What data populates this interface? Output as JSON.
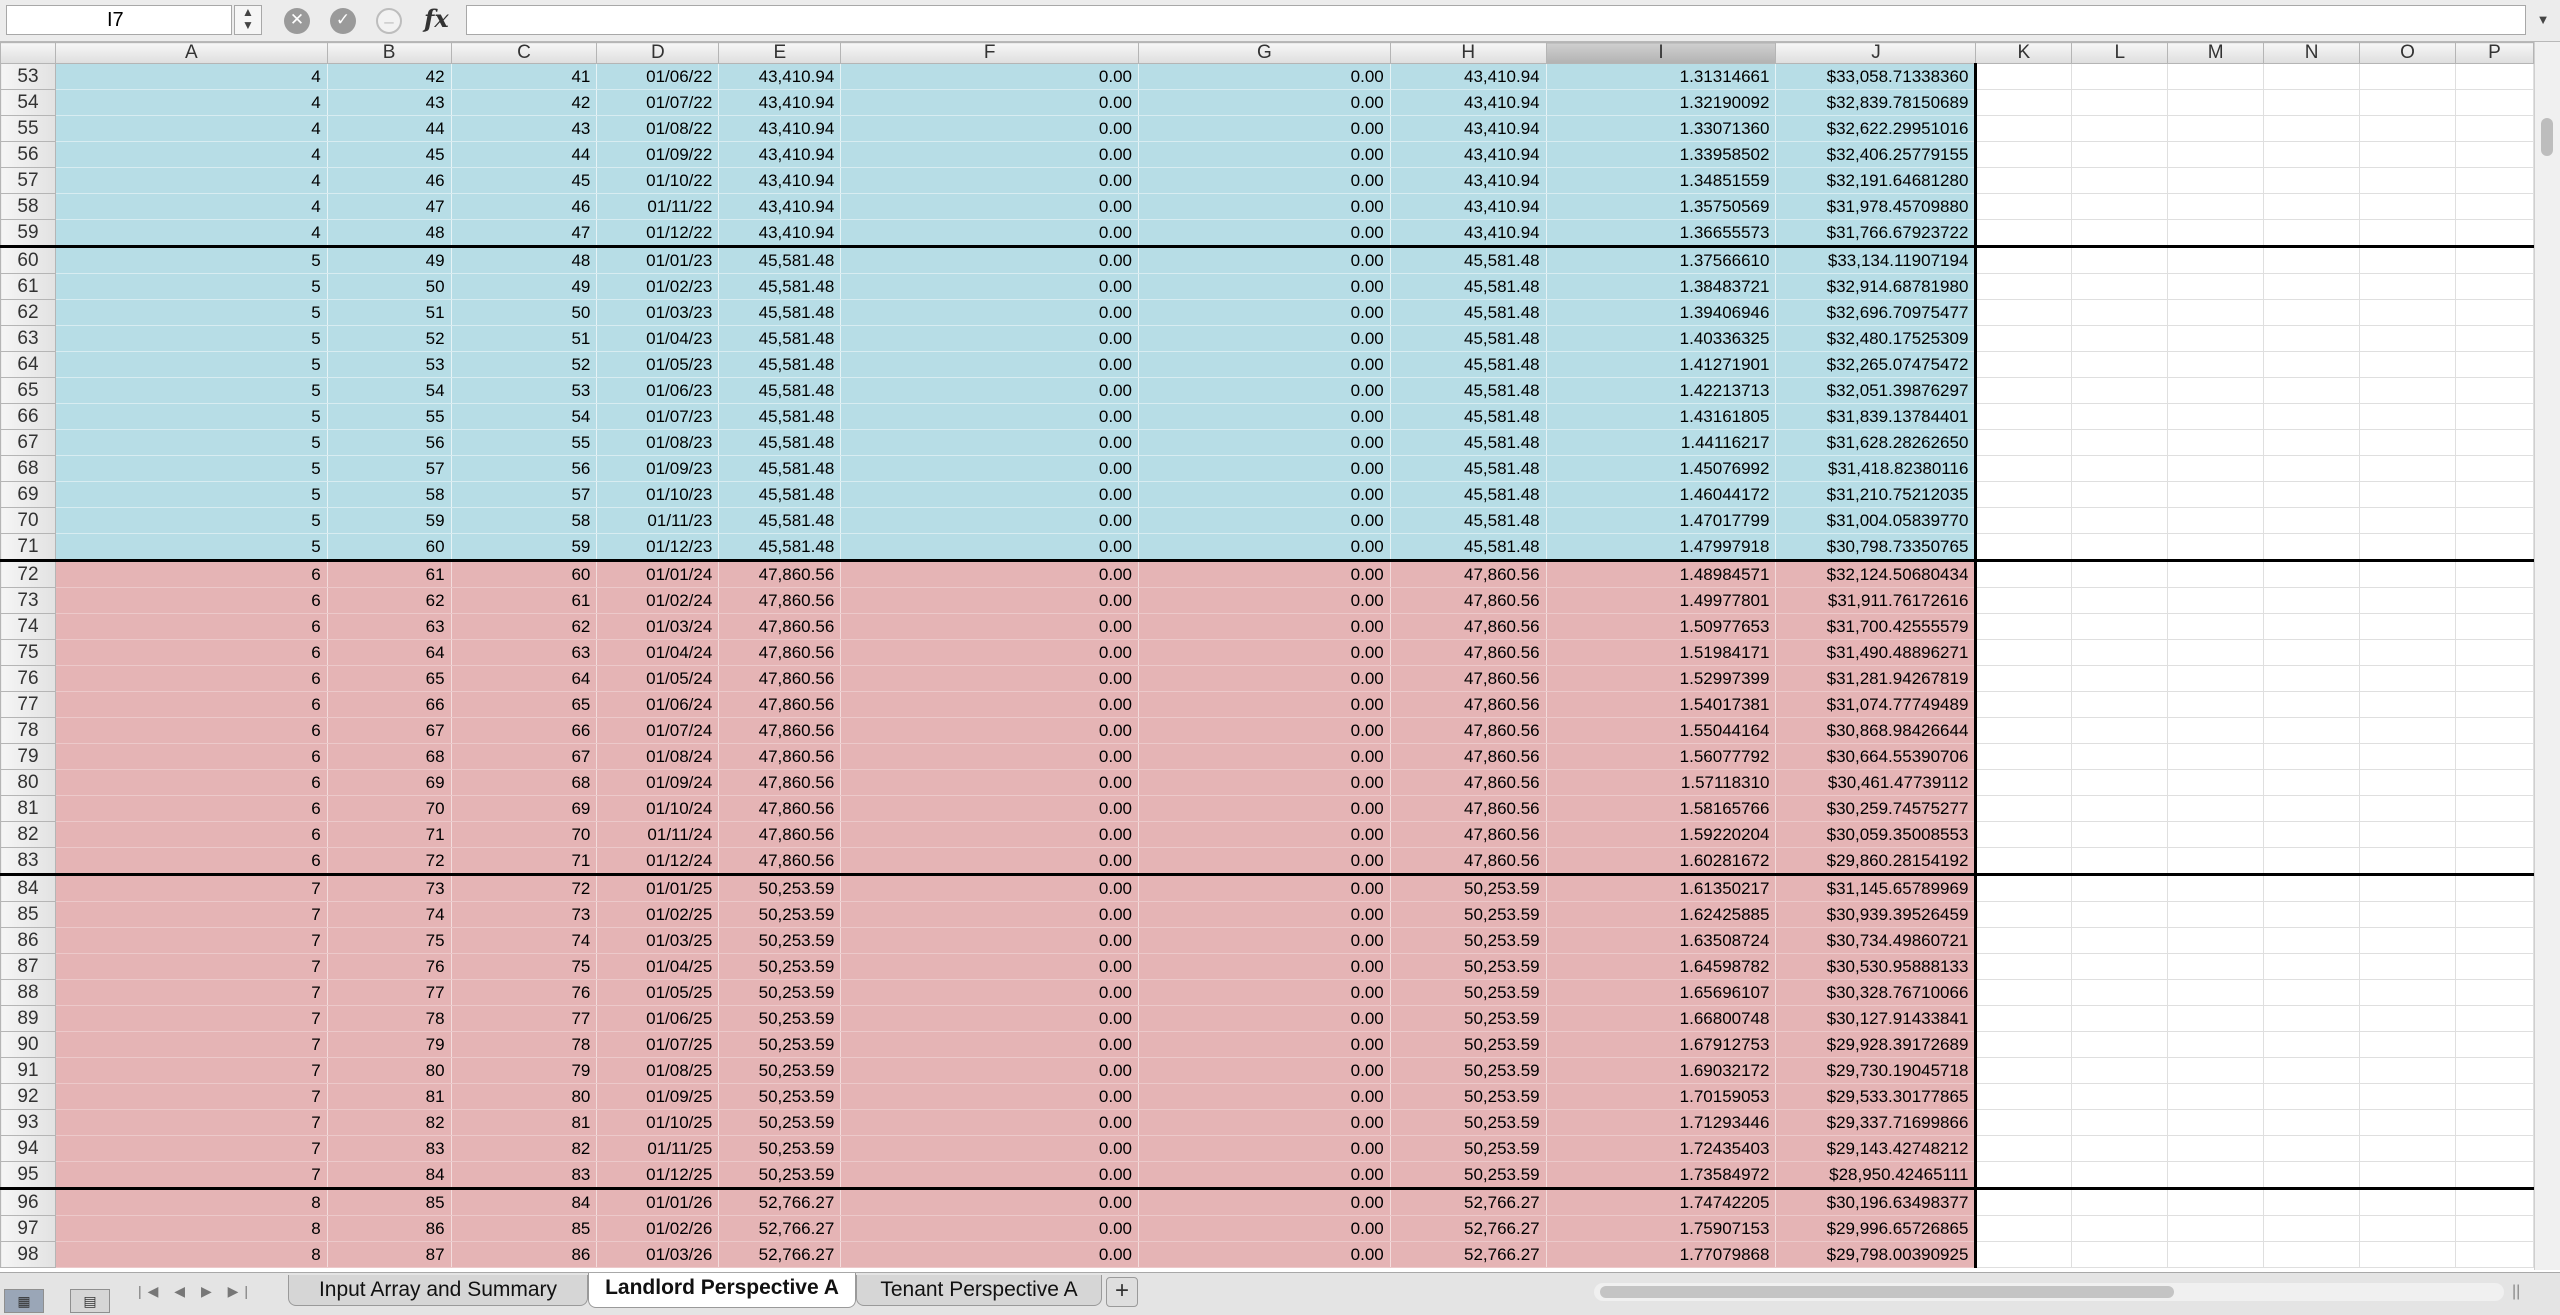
{
  "formula_bar": {
    "cell_ref": "I7",
    "stepper": "▲▼",
    "fx": "fx",
    "formula": "",
    "cancel_glyph": "✕",
    "enter_glyph": "✓",
    "function_glyph": "–",
    "dropdown_glyph": "▼"
  },
  "columns": [
    {
      "label": "A",
      "selected": false
    },
    {
      "label": "B",
      "selected": false
    },
    {
      "label": "C",
      "selected": false
    },
    {
      "label": "D",
      "selected": false
    },
    {
      "label": "E",
      "selected": false
    },
    {
      "label": "F",
      "selected": false
    },
    {
      "label": "G",
      "selected": false
    },
    {
      "label": "H",
      "selected": false
    },
    {
      "label": "I",
      "selected": true
    },
    {
      "label": "J",
      "selected": false
    },
    {
      "label": "K",
      "selected": false
    },
    {
      "label": "L",
      "selected": false
    },
    {
      "label": "M",
      "selected": false
    },
    {
      "label": "N",
      "selected": false
    },
    {
      "label": "O",
      "selected": false
    },
    {
      "label": "P",
      "selected": false
    }
  ],
  "colors": {
    "blue_fill": "#b7dde6",
    "pink_fill": "#e5b4b5",
    "selected_header": "#b2b2b2"
  },
  "rows": [
    {
      "n": "53",
      "f": "blue",
      "brk": false,
      "c": [
        "4",
        "42",
        "41",
        "01/06/22",
        "43,410.94",
        "0.00",
        "0.00",
        "43,410.94",
        "1.31314661",
        "$33,058.71338360"
      ]
    },
    {
      "n": "54",
      "f": "blue",
      "brk": false,
      "c": [
        "4",
        "43",
        "42",
        "01/07/22",
        "43,410.94",
        "0.00",
        "0.00",
        "43,410.94",
        "1.32190092",
        "$32,839.78150689"
      ]
    },
    {
      "n": "55",
      "f": "blue",
      "brk": false,
      "c": [
        "4",
        "44",
        "43",
        "01/08/22",
        "43,410.94",
        "0.00",
        "0.00",
        "43,410.94",
        "1.33071360",
        "$32,622.29951016"
      ]
    },
    {
      "n": "56",
      "f": "blue",
      "brk": false,
      "c": [
        "4",
        "45",
        "44",
        "01/09/22",
        "43,410.94",
        "0.00",
        "0.00",
        "43,410.94",
        "1.33958502",
        "$32,406.25779155"
      ]
    },
    {
      "n": "57",
      "f": "blue",
      "brk": false,
      "c": [
        "4",
        "46",
        "45",
        "01/10/22",
        "43,410.94",
        "0.00",
        "0.00",
        "43,410.94",
        "1.34851559",
        "$32,191.64681280"
      ]
    },
    {
      "n": "58",
      "f": "blue",
      "brk": false,
      "c": [
        "4",
        "47",
        "46",
        "01/11/22",
        "43,410.94",
        "0.00",
        "0.00",
        "43,410.94",
        "1.35750569",
        "$31,978.45709880"
      ]
    },
    {
      "n": "59",
      "f": "blue",
      "brk": false,
      "c": [
        "4",
        "48",
        "47",
        "01/12/22",
        "43,410.94",
        "0.00",
        "0.00",
        "43,410.94",
        "1.36655573",
        "$31,766.67923722"
      ]
    },
    {
      "n": "60",
      "f": "blue",
      "brk": true,
      "c": [
        "5",
        "49",
        "48",
        "01/01/23",
        "45,581.48",
        "0.00",
        "0.00",
        "45,581.48",
        "1.37566610",
        "$33,134.11907194"
      ]
    },
    {
      "n": "61",
      "f": "blue",
      "brk": false,
      "c": [
        "5",
        "50",
        "49",
        "01/02/23",
        "45,581.48",
        "0.00",
        "0.00",
        "45,581.48",
        "1.38483721",
        "$32,914.68781980"
      ]
    },
    {
      "n": "62",
      "f": "blue",
      "brk": false,
      "c": [
        "5",
        "51",
        "50",
        "01/03/23",
        "45,581.48",
        "0.00",
        "0.00",
        "45,581.48",
        "1.39406946",
        "$32,696.70975477"
      ]
    },
    {
      "n": "63",
      "f": "blue",
      "brk": false,
      "c": [
        "5",
        "52",
        "51",
        "01/04/23",
        "45,581.48",
        "0.00",
        "0.00",
        "45,581.48",
        "1.40336325",
        "$32,480.17525309"
      ]
    },
    {
      "n": "64",
      "f": "blue",
      "brk": false,
      "c": [
        "5",
        "53",
        "52",
        "01/05/23",
        "45,581.48",
        "0.00",
        "0.00",
        "45,581.48",
        "1.41271901",
        "$32,265.07475472"
      ]
    },
    {
      "n": "65",
      "f": "blue",
      "brk": false,
      "c": [
        "5",
        "54",
        "53",
        "01/06/23",
        "45,581.48",
        "0.00",
        "0.00",
        "45,581.48",
        "1.42213713",
        "$32,051.39876297"
      ]
    },
    {
      "n": "66",
      "f": "blue",
      "brk": false,
      "c": [
        "5",
        "55",
        "54",
        "01/07/23",
        "45,581.48",
        "0.00",
        "0.00",
        "45,581.48",
        "1.43161805",
        "$31,839.13784401"
      ]
    },
    {
      "n": "67",
      "f": "blue",
      "brk": false,
      "c": [
        "5",
        "56",
        "55",
        "01/08/23",
        "45,581.48",
        "0.00",
        "0.00",
        "45,581.48",
        "1.44116217",
        "$31,628.28262650"
      ]
    },
    {
      "n": "68",
      "f": "blue",
      "brk": false,
      "c": [
        "5",
        "57",
        "56",
        "01/09/23",
        "45,581.48",
        "0.00",
        "0.00",
        "45,581.48",
        "1.45076992",
        "$31,418.82380116"
      ]
    },
    {
      "n": "69",
      "f": "blue",
      "brk": false,
      "c": [
        "5",
        "58",
        "57",
        "01/10/23",
        "45,581.48",
        "0.00",
        "0.00",
        "45,581.48",
        "1.46044172",
        "$31,210.75212035"
      ]
    },
    {
      "n": "70",
      "f": "blue",
      "brk": false,
      "c": [
        "5",
        "59",
        "58",
        "01/11/23",
        "45,581.48",
        "0.00",
        "0.00",
        "45,581.48",
        "1.47017799",
        "$31,004.05839770"
      ]
    },
    {
      "n": "71",
      "f": "blue",
      "brk": false,
      "c": [
        "5",
        "60",
        "59",
        "01/12/23",
        "45,581.48",
        "0.00",
        "0.00",
        "45,581.48",
        "1.47997918",
        "$30,798.73350765"
      ]
    },
    {
      "n": "72",
      "f": "pink",
      "brk": true,
      "c": [
        "6",
        "61",
        "60",
        "01/01/24",
        "47,860.56",
        "0.00",
        "0.00",
        "47,860.56",
        "1.48984571",
        "$32,124.50680434"
      ]
    },
    {
      "n": "73",
      "f": "pink",
      "brk": false,
      "c": [
        "6",
        "62",
        "61",
        "01/02/24",
        "47,860.56",
        "0.00",
        "0.00",
        "47,860.56",
        "1.49977801",
        "$31,911.76172616"
      ]
    },
    {
      "n": "74",
      "f": "pink",
      "brk": false,
      "c": [
        "6",
        "63",
        "62",
        "01/03/24",
        "47,860.56",
        "0.00",
        "0.00",
        "47,860.56",
        "1.50977653",
        "$31,700.42555579"
      ]
    },
    {
      "n": "75",
      "f": "pink",
      "brk": false,
      "c": [
        "6",
        "64",
        "63",
        "01/04/24",
        "47,860.56",
        "0.00",
        "0.00",
        "47,860.56",
        "1.51984171",
        "$31,490.48896271"
      ]
    },
    {
      "n": "76",
      "f": "pink",
      "brk": false,
      "c": [
        "6",
        "65",
        "64",
        "01/05/24",
        "47,860.56",
        "0.00",
        "0.00",
        "47,860.56",
        "1.52997399",
        "$31,281.94267819"
      ]
    },
    {
      "n": "77",
      "f": "pink",
      "brk": false,
      "c": [
        "6",
        "66",
        "65",
        "01/06/24",
        "47,860.56",
        "0.00",
        "0.00",
        "47,860.56",
        "1.54017381",
        "$31,074.77749489"
      ]
    },
    {
      "n": "78",
      "f": "pink",
      "brk": false,
      "c": [
        "6",
        "67",
        "66",
        "01/07/24",
        "47,860.56",
        "0.00",
        "0.00",
        "47,860.56",
        "1.55044164",
        "$30,868.98426644"
      ]
    },
    {
      "n": "79",
      "f": "pink",
      "brk": false,
      "c": [
        "6",
        "68",
        "67",
        "01/08/24",
        "47,860.56",
        "0.00",
        "0.00",
        "47,860.56",
        "1.56077792",
        "$30,664.55390706"
      ]
    },
    {
      "n": "80",
      "f": "pink",
      "brk": false,
      "c": [
        "6",
        "69",
        "68",
        "01/09/24",
        "47,860.56",
        "0.00",
        "0.00",
        "47,860.56",
        "1.57118310",
        "$30,461.47739112"
      ]
    },
    {
      "n": "81",
      "f": "pink",
      "brk": false,
      "c": [
        "6",
        "70",
        "69",
        "01/10/24",
        "47,860.56",
        "0.00",
        "0.00",
        "47,860.56",
        "1.58165766",
        "$30,259.74575277"
      ]
    },
    {
      "n": "82",
      "f": "pink",
      "brk": false,
      "c": [
        "6",
        "71",
        "70",
        "01/11/24",
        "47,860.56",
        "0.00",
        "0.00",
        "47,860.56",
        "1.59220204",
        "$30,059.35008553"
      ]
    },
    {
      "n": "83",
      "f": "pink",
      "brk": false,
      "c": [
        "6",
        "72",
        "71",
        "01/12/24",
        "47,860.56",
        "0.00",
        "0.00",
        "47,860.56",
        "1.60281672",
        "$29,860.28154192"
      ]
    },
    {
      "n": "84",
      "f": "pink",
      "brk": true,
      "c": [
        "7",
        "73",
        "72",
        "01/01/25",
        "50,253.59",
        "0.00",
        "0.00",
        "50,253.59",
        "1.61350217",
        "$31,145.65789969"
      ]
    },
    {
      "n": "85",
      "f": "pink",
      "brk": false,
      "c": [
        "7",
        "74",
        "73",
        "01/02/25",
        "50,253.59",
        "0.00",
        "0.00",
        "50,253.59",
        "1.62425885",
        "$30,939.39526459"
      ]
    },
    {
      "n": "86",
      "f": "pink",
      "brk": false,
      "c": [
        "7",
        "75",
        "74",
        "01/03/25",
        "50,253.59",
        "0.00",
        "0.00",
        "50,253.59",
        "1.63508724",
        "$30,734.49860721"
      ]
    },
    {
      "n": "87",
      "f": "pink",
      "brk": false,
      "c": [
        "7",
        "76",
        "75",
        "01/04/25",
        "50,253.59",
        "0.00",
        "0.00",
        "50,253.59",
        "1.64598782",
        "$30,530.95888133"
      ]
    },
    {
      "n": "88",
      "f": "pink",
      "brk": false,
      "c": [
        "7",
        "77",
        "76",
        "01/05/25",
        "50,253.59",
        "0.00",
        "0.00",
        "50,253.59",
        "1.65696107",
        "$30,328.76710066"
      ]
    },
    {
      "n": "89",
      "f": "pink",
      "brk": false,
      "c": [
        "7",
        "78",
        "77",
        "01/06/25",
        "50,253.59",
        "0.00",
        "0.00",
        "50,253.59",
        "1.66800748",
        "$30,127.91433841"
      ]
    },
    {
      "n": "90",
      "f": "pink",
      "brk": false,
      "c": [
        "7",
        "79",
        "78",
        "01/07/25",
        "50,253.59",
        "0.00",
        "0.00",
        "50,253.59",
        "1.67912753",
        "$29,928.39172689"
      ]
    },
    {
      "n": "91",
      "f": "pink",
      "brk": false,
      "c": [
        "7",
        "80",
        "79",
        "01/08/25",
        "50,253.59",
        "0.00",
        "0.00",
        "50,253.59",
        "1.69032172",
        "$29,730.19045718"
      ]
    },
    {
      "n": "92",
      "f": "pink",
      "brk": false,
      "c": [
        "7",
        "81",
        "80",
        "01/09/25",
        "50,253.59",
        "0.00",
        "0.00",
        "50,253.59",
        "1.70159053",
        "$29,533.30177865"
      ]
    },
    {
      "n": "93",
      "f": "pink",
      "brk": false,
      "c": [
        "7",
        "82",
        "81",
        "01/10/25",
        "50,253.59",
        "0.00",
        "0.00",
        "50,253.59",
        "1.71293446",
        "$29,337.71699866"
      ]
    },
    {
      "n": "94",
      "f": "pink",
      "brk": false,
      "c": [
        "7",
        "83",
        "82",
        "01/11/25",
        "50,253.59",
        "0.00",
        "0.00",
        "50,253.59",
        "1.72435403",
        "$29,143.42748212"
      ]
    },
    {
      "n": "95",
      "f": "pink",
      "brk": false,
      "c": [
        "7",
        "84",
        "83",
        "01/12/25",
        "50,253.59",
        "0.00",
        "0.00",
        "50,253.59",
        "1.73584972",
        "$28,950.42465111"
      ]
    },
    {
      "n": "96",
      "f": "pink",
      "brk": true,
      "c": [
        "8",
        "85",
        "84",
        "01/01/26",
        "52,766.27",
        "0.00",
        "0.00",
        "52,766.27",
        "1.74742205",
        "$30,196.63498377"
      ]
    },
    {
      "n": "97",
      "f": "pink",
      "brk": false,
      "c": [
        "8",
        "86",
        "85",
        "01/02/26",
        "52,766.27",
        "0.00",
        "0.00",
        "52,766.27",
        "1.75907153",
        "$29,996.65726865"
      ]
    },
    {
      "n": "98",
      "f": "pink",
      "brk": false,
      "c": [
        "8",
        "87",
        "86",
        "01/03/26",
        "52,766.27",
        "0.00",
        "0.00",
        "52,766.27",
        "1.77079868",
        "$29,798.00390925"
      ]
    }
  ],
  "sheet_tabs": [
    {
      "label": "Input Array and Summary",
      "active": false
    },
    {
      "label": "Landlord Perspective A",
      "active": true
    },
    {
      "label": "Tenant Perspective A",
      "active": false
    }
  ],
  "add_sheet_label": "+",
  "tab_nav_glyphs": "|◀ ◀ ▶ ▶|",
  "view_buttons": {
    "normal": "▦",
    "layout": "▤"
  }
}
